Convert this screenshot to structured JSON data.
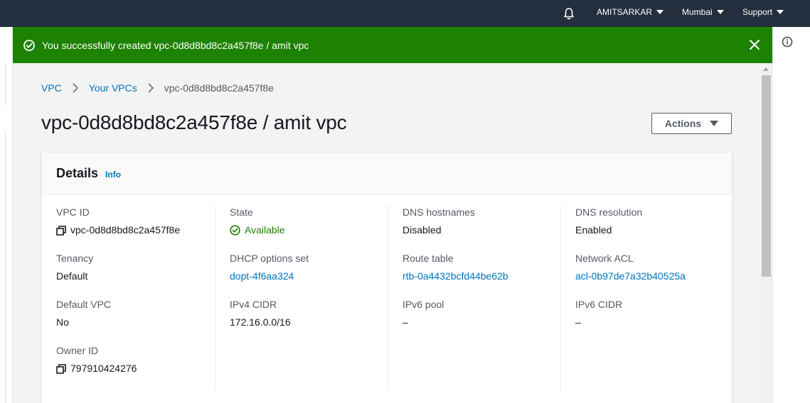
{
  "topnav": {
    "bell_icon": "bell-icon",
    "account_label": "AMITSARKAR",
    "region_label": "Mumbai",
    "support_label": "Support"
  },
  "flash": {
    "message": "You successfully created vpc-0d8d8bd8c2a457f8e / amit vpc",
    "color": "#1d8102",
    "icons": [
      "success-icon",
      "close-icon"
    ]
  },
  "breadcrumb": {
    "items": [
      "VPC",
      "Your VPCs"
    ],
    "current": "vpc-0d8d8bd8c2a457f8e"
  },
  "page": {
    "title": "vpc-0d8d8bd8c2a457f8e / amit vpc",
    "actions_label": "Actions"
  },
  "details": {
    "heading": "Details",
    "info_label": "Info",
    "columns": [
      [
        {
          "label": "VPC ID",
          "value": "vpc-0d8d8bd8c2a457f8e"
        },
        {
          "label": "Tenancy",
          "value": "Default"
        },
        {
          "label": "Default VPC",
          "value": "No"
        },
        {
          "label": "Owner ID",
          "value": "797910424276"
        }
      ],
      [
        {
          "label": "State",
          "value": "Available"
        },
        {
          "label": "DHCP options set",
          "value": "dopt-4f6aa324"
        },
        {
          "label": "IPv4 CIDR",
          "value": "172.16.0.0/16"
        }
      ],
      [
        {
          "label": "DNS hostnames",
          "value": "Disabled"
        },
        {
          "label": "Route table",
          "value": "rtb-0a4432bcfd44be62b"
        },
        {
          "label": "IPv6 pool",
          "value": "–"
        }
      ],
      [
        {
          "label": "DNS resolution",
          "value": "Enabled"
        },
        {
          "label": "Network ACL",
          "value": "acl-0b97de7a32b40525a"
        },
        {
          "label": "IPv6 CIDR",
          "value": "–"
        }
      ]
    ]
  },
  "colors": {
    "nav_bg": "#232f3e",
    "link": "#0073bb",
    "success": "#1d8102"
  }
}
